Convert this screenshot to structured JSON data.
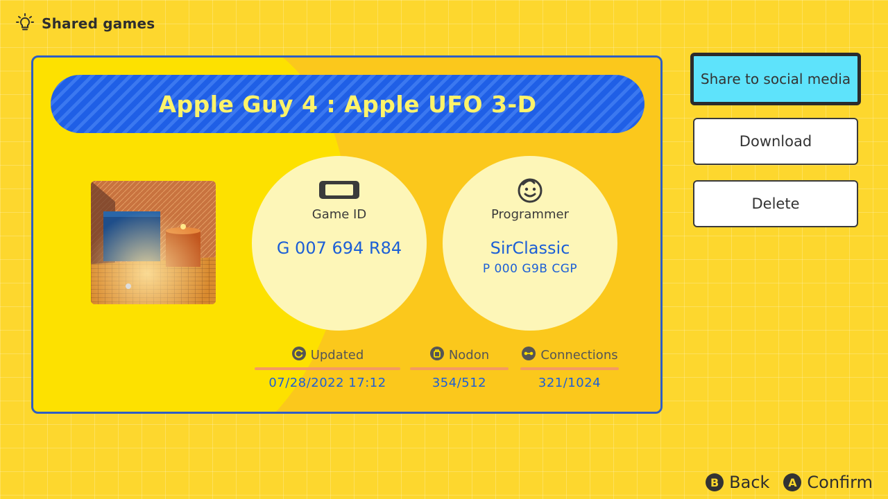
{
  "header": {
    "title": "Shared games",
    "icon": "lightbulb-icon"
  },
  "game": {
    "title": "Apple Guy 4 : Apple UFO 3-D",
    "id_label": "Game ID",
    "id_value": "G 007 694 R84",
    "programmer_label": "Programmer",
    "programmer_name": "SirClassic",
    "programmer_id": "P 000 G9B CGP"
  },
  "stats": {
    "updated": {
      "label": "Updated",
      "value": "07/28/2022 17:12"
    },
    "nodon": {
      "label": "Nodon",
      "value": "354/512"
    },
    "connections": {
      "label": "Connections",
      "value": "321/1024"
    }
  },
  "actions": {
    "share": "Share to social media",
    "download": "Download",
    "delete": "Delete"
  },
  "footer": {
    "back_key": "B",
    "back_label": "Back",
    "confirm_key": "A",
    "confirm_label": "Confirm"
  },
  "colors": {
    "background": "#fdd72e",
    "banner": "#1f5fe6",
    "accent_text": "#1c5fd6",
    "selected_button": "#5ee3fb"
  }
}
